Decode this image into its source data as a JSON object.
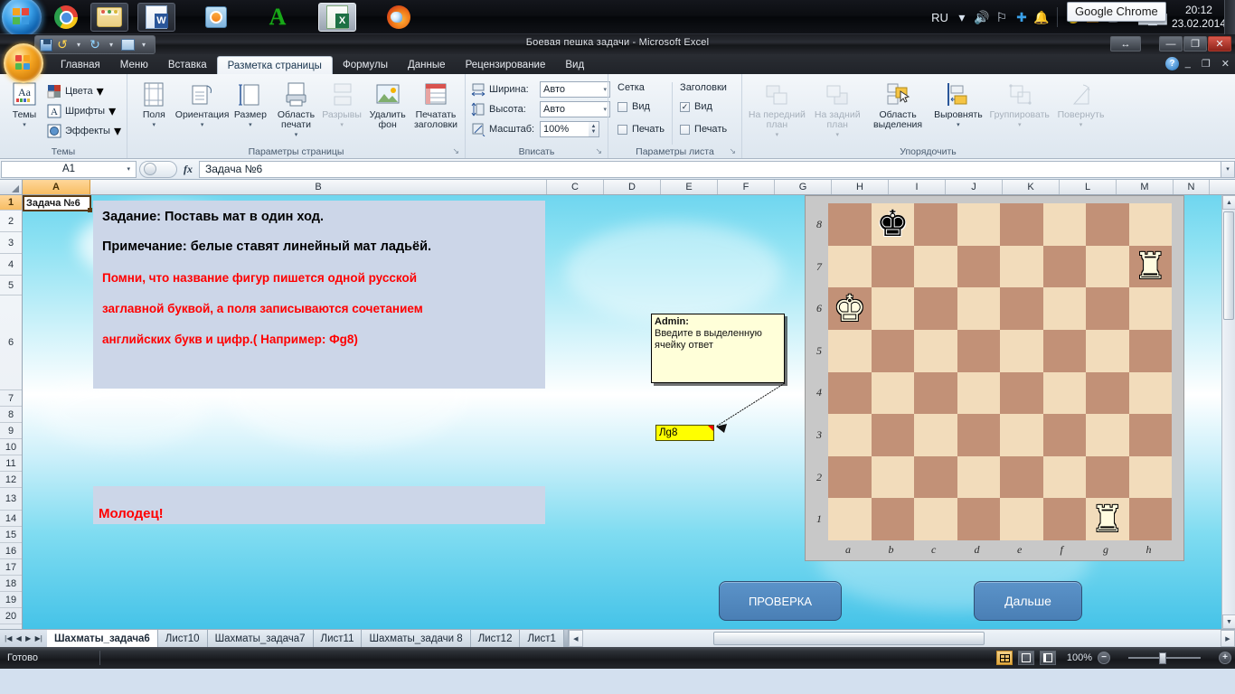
{
  "taskbar": {
    "start_label": "start-orb",
    "items": [
      {
        "name": "chrome",
        "label": "Google Chrome"
      },
      {
        "name": "explorer",
        "label": "Проводник"
      },
      {
        "name": "word",
        "label": "Microsoft Word"
      },
      {
        "name": "media",
        "label": "Проигрыватель"
      },
      {
        "name": "abbyy",
        "label": "ABBYY"
      },
      {
        "name": "excel",
        "label": "Microsoft Excel"
      },
      {
        "name": "firefox",
        "label": "Mozilla Firefox"
      }
    ],
    "tooltip": "Google Chrome",
    "lang": "RU",
    "time": "20:12",
    "date": "23.02.2014"
  },
  "window": {
    "title": "Боевая пешка задачи  -  Microsoft Excel",
    "minimize": "—",
    "restore": "❐",
    "close": "✕",
    "resize_icon": "↔"
  },
  "qat": {
    "save": "save-icon",
    "undo": "↺",
    "redo": "↻",
    "picture": "picture-icon",
    "more": "▾"
  },
  "ribbon": {
    "tabs": [
      {
        "label": "Главная",
        "selected": false
      },
      {
        "label": "Меню",
        "selected": false
      },
      {
        "label": "Вставка",
        "selected": false
      },
      {
        "label": "Разметка страницы",
        "selected": true
      },
      {
        "label": "Формулы",
        "selected": false
      },
      {
        "label": "Данные",
        "selected": false
      },
      {
        "label": "Рецензирование",
        "selected": false
      },
      {
        "label": "Вид",
        "selected": false
      }
    ],
    "help": "?",
    "min": "_",
    "max": "❐",
    "close": "✕",
    "groups": [
      {
        "title": "Темы",
        "big": [
          {
            "label": "Темы",
            "caret": "▾"
          }
        ],
        "small": [
          {
            "label": "Цвета",
            "caret": "▾",
            "icon": "colors-icon"
          },
          {
            "label": "Шрифты",
            "caret": "▾",
            "icon": "fonts-icon"
          },
          {
            "label": "Эффекты",
            "caret": "▾",
            "icon": "effects-icon"
          }
        ]
      },
      {
        "title": "Параметры страницы",
        "launcher": "↘",
        "big": [
          {
            "label": "Поля",
            "caret": "▾",
            "disabled": false
          },
          {
            "label": "Ориентация",
            "caret": "▾",
            "disabled": false
          },
          {
            "label": "Размер",
            "caret": "▾",
            "disabled": false
          },
          {
            "label": "Область печати",
            "caret": "▾",
            "disabled": false
          },
          {
            "label": "Разрывы",
            "caret": "▾",
            "disabled": true
          },
          {
            "label": "Удалить фон",
            "caret": "",
            "disabled": false
          },
          {
            "label": "Печатать заголовки",
            "caret": "",
            "disabled": false
          }
        ]
      },
      {
        "title": "Вписать",
        "launcher": "↘",
        "rows": [
          {
            "label": "Ширина:",
            "value": "Авто",
            "caret": "▾",
            "spinner": false
          },
          {
            "label": "Высота:",
            "value": "Авто",
            "caret": "▾",
            "spinner": false
          },
          {
            "label": "Масштаб:",
            "value": "100%",
            "caret": "",
            "spinner": true
          }
        ]
      },
      {
        "title": "Параметры листа",
        "launcher": "↘",
        "columns": [
          {
            "header": "Сетка",
            "checks": [
              {
                "label": "Вид",
                "checked": false
              },
              {
                "label": "Печать",
                "checked": false
              }
            ]
          },
          {
            "header": "Заголовки",
            "checks": [
              {
                "label": "Вид",
                "checked": true
              },
              {
                "label": "Печать",
                "checked": false
              }
            ]
          }
        ]
      },
      {
        "title": "Упорядочить",
        "big": [
          {
            "label": "На передний план",
            "caret": "▾",
            "disabled": true
          },
          {
            "label": "На задний план",
            "caret": "▾",
            "disabled": true
          },
          {
            "label": "Область выделения",
            "caret": "",
            "disabled": false
          },
          {
            "label": "Выровнять",
            "caret": "▾",
            "disabled": false
          },
          {
            "label": "Группировать",
            "caret": "▾",
            "disabled": true
          },
          {
            "label": "Повернуть",
            "caret": "▾",
            "disabled": true
          }
        ]
      }
    ]
  },
  "formula_bar": {
    "name_box": "A1",
    "name_box_caret": "▾",
    "fx": "fx",
    "value": "Задача №6",
    "expand": "▾"
  },
  "grid": {
    "columns": [
      "A",
      "B",
      "C",
      "D",
      "E",
      "F",
      "G",
      "H",
      "I",
      "J",
      "K",
      "L",
      "M",
      "N"
    ],
    "selected_column": "A",
    "rows": [
      "1",
      "2",
      "3",
      "4",
      "5",
      "6",
      "7",
      "8",
      "9",
      "10",
      "11",
      "12",
      "13",
      "14",
      "15",
      "16",
      "17",
      "18",
      "19",
      "20"
    ],
    "selected_row": "1",
    "cell_a1": "Задача №6"
  },
  "content": {
    "task_lines": [
      " Задание: Поставь мат в один  ход.",
      "Примечание: белые ставят линейный мат ладьёй."
    ],
    "note_lines": [
      "Помни, что название фигур пишется одной русской",
      "заглавной буквой, а поля записываются сочетанием",
      "английских букв и цифр.( Например: Фg8)"
    ],
    "praise": "Молодец!",
    "comment": {
      "author": "Admin:",
      "text": "Введите в  выделенную ячейку ответ"
    },
    "answer_cell": "Лg8",
    "buttons": {
      "check": "ПРОВЕРКА",
      "next": "Дальше"
    }
  },
  "chessboard": {
    "files": [
      "a",
      "b",
      "c",
      "d",
      "e",
      "f",
      "g",
      "h"
    ],
    "ranks": [
      "8",
      "7",
      "6",
      "5",
      "4",
      "3",
      "2",
      "1"
    ],
    "light_color": "#f2dcbb",
    "dark_color": "#c29177",
    "pieces": [
      {
        "square": "b8",
        "glyph": "♚",
        "color": "black",
        "name": "black-king"
      },
      {
        "square": "h7",
        "glyph": "♜",
        "color": "white",
        "name": "white-rook"
      },
      {
        "square": "a6",
        "glyph": "♚",
        "color": "white",
        "name": "white-king"
      },
      {
        "square": "g1",
        "glyph": "♜",
        "color": "white",
        "name": "white-rook"
      }
    ]
  },
  "sheet_tabs": {
    "nav": [
      "|◀",
      "◀",
      "▶",
      "▶|"
    ],
    "tabs": [
      {
        "label": "Шахматы_задача6",
        "selected": true
      },
      {
        "label": "Лист10",
        "selected": false
      },
      {
        "label": "Шахматы_задача7",
        "selected": false
      },
      {
        "label": "Лист11",
        "selected": false
      },
      {
        "label": "Шахматы_задачи 8",
        "selected": false
      },
      {
        "label": "Лист12",
        "selected": false
      },
      {
        "label": "Лист1",
        "selected": false
      }
    ]
  },
  "status": {
    "ready": "Готово",
    "zoom": "100%",
    "views": [
      "normal-view",
      "page-layout-view",
      "page-break-view"
    ],
    "zoom_out": "−",
    "zoom_in": "+"
  }
}
